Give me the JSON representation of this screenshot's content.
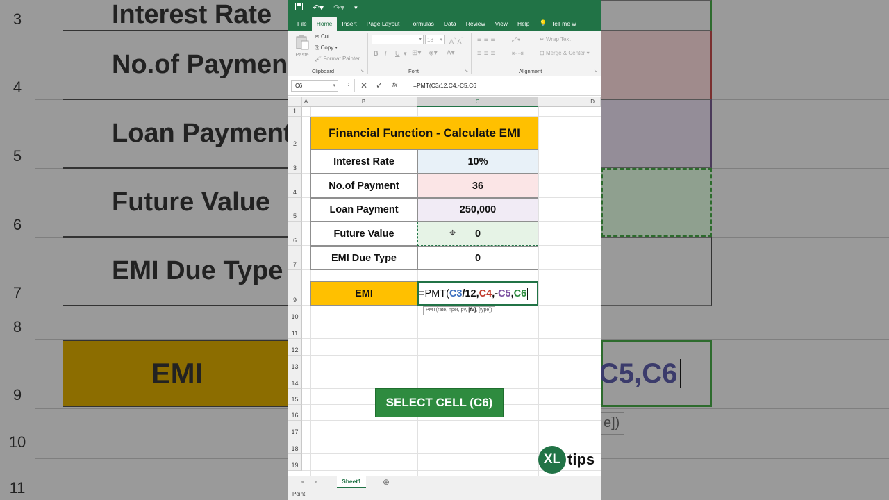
{
  "background": {
    "rows": [
      {
        "num": "3",
        "text": "Interest Rate"
      },
      {
        "num": "4",
        "text": "No.of Payment"
      },
      {
        "num": "5",
        "text": "Loan Payment"
      },
      {
        "num": "6",
        "text": "Future Value"
      },
      {
        "num": "7",
        "text": "EMI Due Type"
      },
      {
        "num": "8",
        "text": ""
      },
      {
        "num": "9",
        "text": "EMI"
      },
      {
        "num": "10",
        "text": ""
      },
      {
        "num": "11",
        "text": ""
      }
    ],
    "right_formula": "C5,C6",
    "right_tooltip": "e])"
  },
  "qat": {
    "save": "save-icon",
    "undo": "undo-icon",
    "redo": "redo-icon"
  },
  "tabs": [
    "File",
    "Home",
    "Insert",
    "Page Layout",
    "Formulas",
    "Data",
    "Review",
    "View",
    "Help",
    "Tell me w"
  ],
  "ribbon": {
    "paste": "Paste",
    "cut": "Cut",
    "copy": "Copy",
    "format_painter": "Format Painter",
    "clipboard": "Clipboard",
    "font_size": "18",
    "font": "Font",
    "wrap_text": "Wrap Text",
    "merge_center": "Merge & Center",
    "alignment": "Alignment",
    "bold": "B",
    "italic": "I",
    "underline": "U"
  },
  "formula_bar": {
    "name_box": "C6",
    "fx": "fx",
    "formula": "=PMT(C3/12,C4,-C5,C6"
  },
  "columns": [
    "A",
    "B",
    "C",
    "D"
  ],
  "row_numbers": [
    "1",
    "2",
    "3",
    "4",
    "5",
    "6",
    "7",
    "",
    "9",
    "10",
    "11",
    "12",
    "13",
    "14",
    "15",
    "16",
    "17",
    "18",
    "19"
  ],
  "sheet": {
    "title": "Financial Function - Calculate EMI",
    "rows": [
      {
        "label": "Interest Rate",
        "value": "10%"
      },
      {
        "label": "No.of Payment",
        "value": "36"
      },
      {
        "label": "Loan Payment",
        "value": "250,000"
      },
      {
        "label": "Future Value",
        "value": "0"
      },
      {
        "label": "EMI Due Type",
        "value": "0"
      }
    ],
    "emi_label": "EMI",
    "formula_parts": [
      "=PMT(",
      "C3",
      "/12,",
      "C4",
      ",-",
      "C5",
      ",",
      "C6"
    ],
    "formula_colors": [
      "#111111",
      "#3c6fbf",
      "#111111",
      "#c0392b",
      "#111111",
      "#7c4fa0",
      "#111111",
      "#2e8b3f"
    ],
    "tooltip_parts": [
      "PMT(rate, nper, pv, ",
      "[fv]",
      ", [type])"
    ]
  },
  "cell_colors": [
    "#e8f1f8",
    "#fbe5e6",
    "#f1ebf5",
    "#e6f3e6",
    "#ffffff"
  ],
  "cta": "SELECT CELL (C6)",
  "logo": {
    "mark": "XL",
    "text": "tips"
  },
  "sheet_tab": "Sheet1",
  "status": "Point"
}
